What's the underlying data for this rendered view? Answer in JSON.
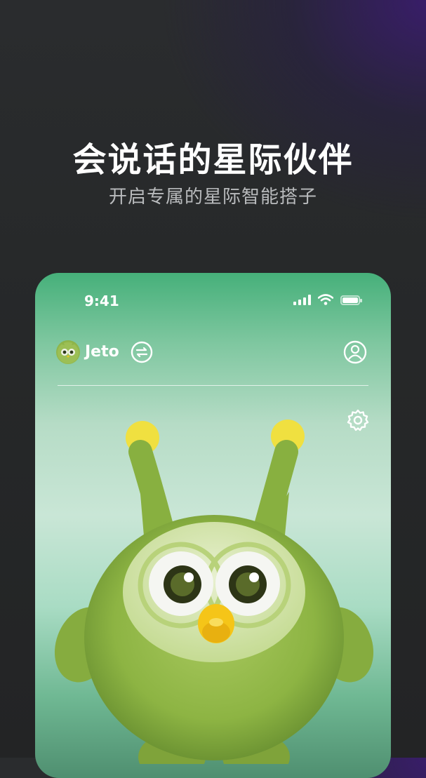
{
  "hero": {
    "title": "会说话的星际伙伴",
    "subtitle": "开启专属的星际智能搭子"
  },
  "status_bar": {
    "time": "9:41",
    "icons": [
      "signal-icon",
      "wifi-icon",
      "battery-icon"
    ]
  },
  "header": {
    "avatar_icon": "owl-avatar-icon",
    "name": "Jeto",
    "switch_icon": "swap-icon",
    "profile_icon": "user-circle-icon"
  },
  "toolbar": {
    "settings_icon": "gear-icon"
  },
  "mascot": {
    "description_icon": "green-owl-mascot"
  },
  "colors": {
    "background": "#252627",
    "accent_purple": "#3a1c6e",
    "phone_green": "#46b07a",
    "mascot_green": "#8eb448",
    "beak_yellow": "#f5c518"
  }
}
